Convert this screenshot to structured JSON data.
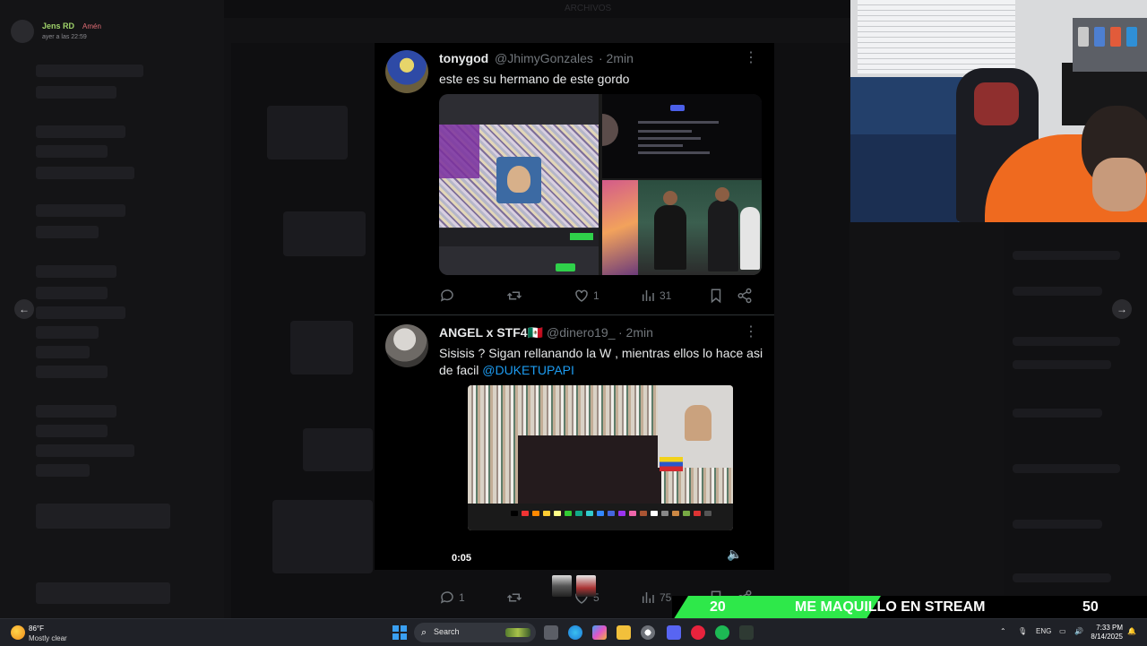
{
  "window": {
    "top_title": "ARCHIVOS"
  },
  "discord_header": {
    "user_name": "Jens RD",
    "badge": "Amén",
    "timestamp": "ayer a las 22:59"
  },
  "nav": {
    "prev": "←",
    "next": "→"
  },
  "tweets": [
    {
      "user": "tonygod",
      "handle": "@JhimyGonzales",
      "time": "· 2min",
      "text": "este es su hermano de este gordo",
      "replies": "",
      "reposts": "",
      "likes": "1",
      "views": "31"
    },
    {
      "user": "ANGEL x STF4🇲🇽",
      "handle": "@dinero19_",
      "time": "· 2min",
      "text_main": "Sisisis ? Sigan rellanando la W , mientras ellos lo hace asi de facil ",
      "mention": "@DUKETUPAPI",
      "video_time": "0:05",
      "replies": "1",
      "reposts": "",
      "likes": "5",
      "views": "75"
    }
  ],
  "ticker": {
    "left_number": "20",
    "text": "ME MAQUILLO EN STREAM",
    "right_number": "50",
    "accent": "#2ee84a"
  },
  "taskbar": {
    "weather_temp": "86°F",
    "weather_desc": "Mostly clear",
    "search_label": "Search",
    "language": "ENG",
    "time": "7:33 PM",
    "date": "8/14/2025"
  },
  "icons": {
    "reply": "reply-icon",
    "repost": "repost-icon",
    "like": "heart-icon",
    "views": "views-icon",
    "bookmark": "bookmark-icon",
    "share": "share-icon",
    "more": "more-icon",
    "volume": "volume-icon"
  }
}
